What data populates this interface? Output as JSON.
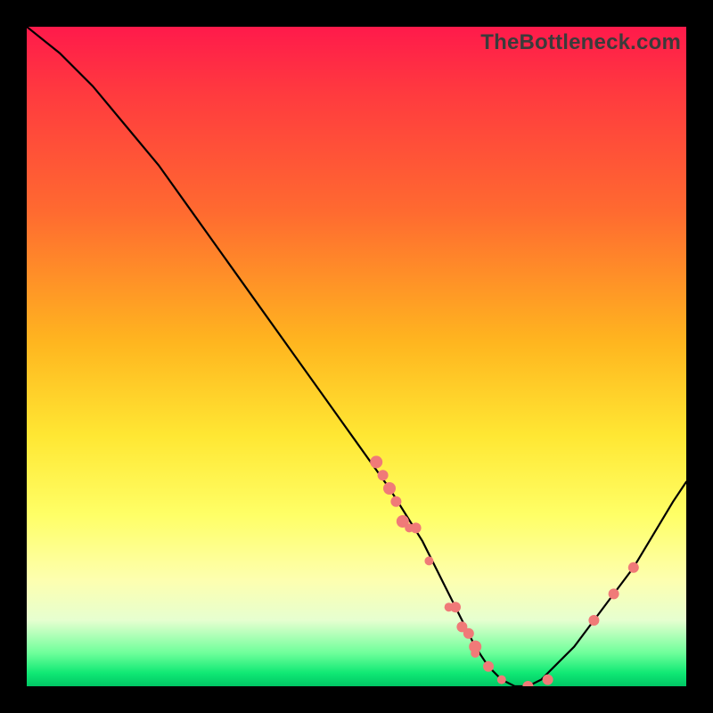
{
  "watermark": {
    "label": "TheBottleneck.com"
  },
  "chart_data": {
    "type": "line",
    "title": "",
    "xlabel": "",
    "ylabel": "",
    "xlim": [
      0,
      100
    ],
    "ylim": [
      0,
      100
    ],
    "grid": false,
    "series": [
      {
        "name": "bottleneck-curve",
        "x": [
          0,
          5,
          10,
          15,
          20,
          25,
          30,
          35,
          40,
          45,
          50,
          55,
          60,
          63,
          66,
          68,
          70,
          72,
          74,
          76,
          78,
          80,
          83,
          86,
          89,
          92,
          95,
          98,
          100
        ],
        "y": [
          100,
          96,
          91,
          85,
          79,
          72,
          65,
          58,
          51,
          44,
          37,
          30,
          22,
          16,
          10,
          6,
          3,
          1,
          0,
          0,
          1,
          3,
          6,
          10,
          14,
          18,
          23,
          28,
          31
        ],
        "stroke": "#000000",
        "stroke_width": 2.2
      }
    ],
    "points": [
      {
        "name": "cluster-left-1",
        "x": 53,
        "y": 34,
        "r": 7,
        "fill": "#f07a78"
      },
      {
        "name": "cluster-left-2",
        "x": 54,
        "y": 32,
        "r": 6,
        "fill": "#f07a78"
      },
      {
        "name": "cluster-left-3",
        "x": 55,
        "y": 30,
        "r": 7,
        "fill": "#f07a78"
      },
      {
        "name": "cluster-left-4",
        "x": 56,
        "y": 28,
        "r": 6,
        "fill": "#f07a78"
      },
      {
        "name": "cluster-left-5",
        "x": 57,
        "y": 25,
        "r": 7,
        "fill": "#f07a78"
      },
      {
        "name": "cluster-left-6",
        "x": 58,
        "y": 24,
        "r": 5,
        "fill": "#f07a78"
      },
      {
        "name": "cluster-left-7",
        "x": 59,
        "y": 24,
        "r": 6,
        "fill": "#f07a78"
      },
      {
        "name": "cluster-left-8",
        "x": 61,
        "y": 19,
        "r": 5,
        "fill": "#f07a78"
      },
      {
        "name": "cluster-mid-1",
        "x": 64,
        "y": 12,
        "r": 5,
        "fill": "#f07a78"
      },
      {
        "name": "cluster-mid-2",
        "x": 65,
        "y": 12,
        "r": 6,
        "fill": "#f07a78"
      },
      {
        "name": "cluster-mid-3",
        "x": 66,
        "y": 9,
        "r": 6,
        "fill": "#f07a78"
      },
      {
        "name": "cluster-mid-4",
        "x": 67,
        "y": 8,
        "r": 6,
        "fill": "#f07a78"
      },
      {
        "name": "cluster-mid-5",
        "x": 68,
        "y": 6,
        "r": 7,
        "fill": "#f07a78"
      },
      {
        "name": "cluster-mid-6",
        "x": 68,
        "y": 5,
        "r": 5,
        "fill": "#f07a78"
      },
      {
        "name": "cluster-mid-7",
        "x": 70,
        "y": 3,
        "r": 6,
        "fill": "#f07a78"
      },
      {
        "name": "bottom-1",
        "x": 72,
        "y": 1,
        "r": 5,
        "fill": "#f07a78"
      },
      {
        "name": "bottom-2",
        "x": 76,
        "y": 0,
        "r": 6,
        "fill": "#f07a78"
      },
      {
        "name": "bottom-3",
        "x": 79,
        "y": 1,
        "r": 6,
        "fill": "#f07a78"
      },
      {
        "name": "right-1",
        "x": 86,
        "y": 10,
        "r": 6,
        "fill": "#f07a78"
      },
      {
        "name": "right-2",
        "x": 89,
        "y": 14,
        "r": 6,
        "fill": "#f07a78"
      },
      {
        "name": "right-3",
        "x": 92,
        "y": 18,
        "r": 6,
        "fill": "#f07a78"
      }
    ],
    "gradient_stops": [
      {
        "pos": 0,
        "color": "#ff1a4b"
      },
      {
        "pos": 28,
        "color": "#ff6a30"
      },
      {
        "pos": 60,
        "color": "#ffe733"
      },
      {
        "pos": 88,
        "color": "#f0ffc0"
      },
      {
        "pos": 100,
        "color": "#00c765"
      }
    ]
  }
}
